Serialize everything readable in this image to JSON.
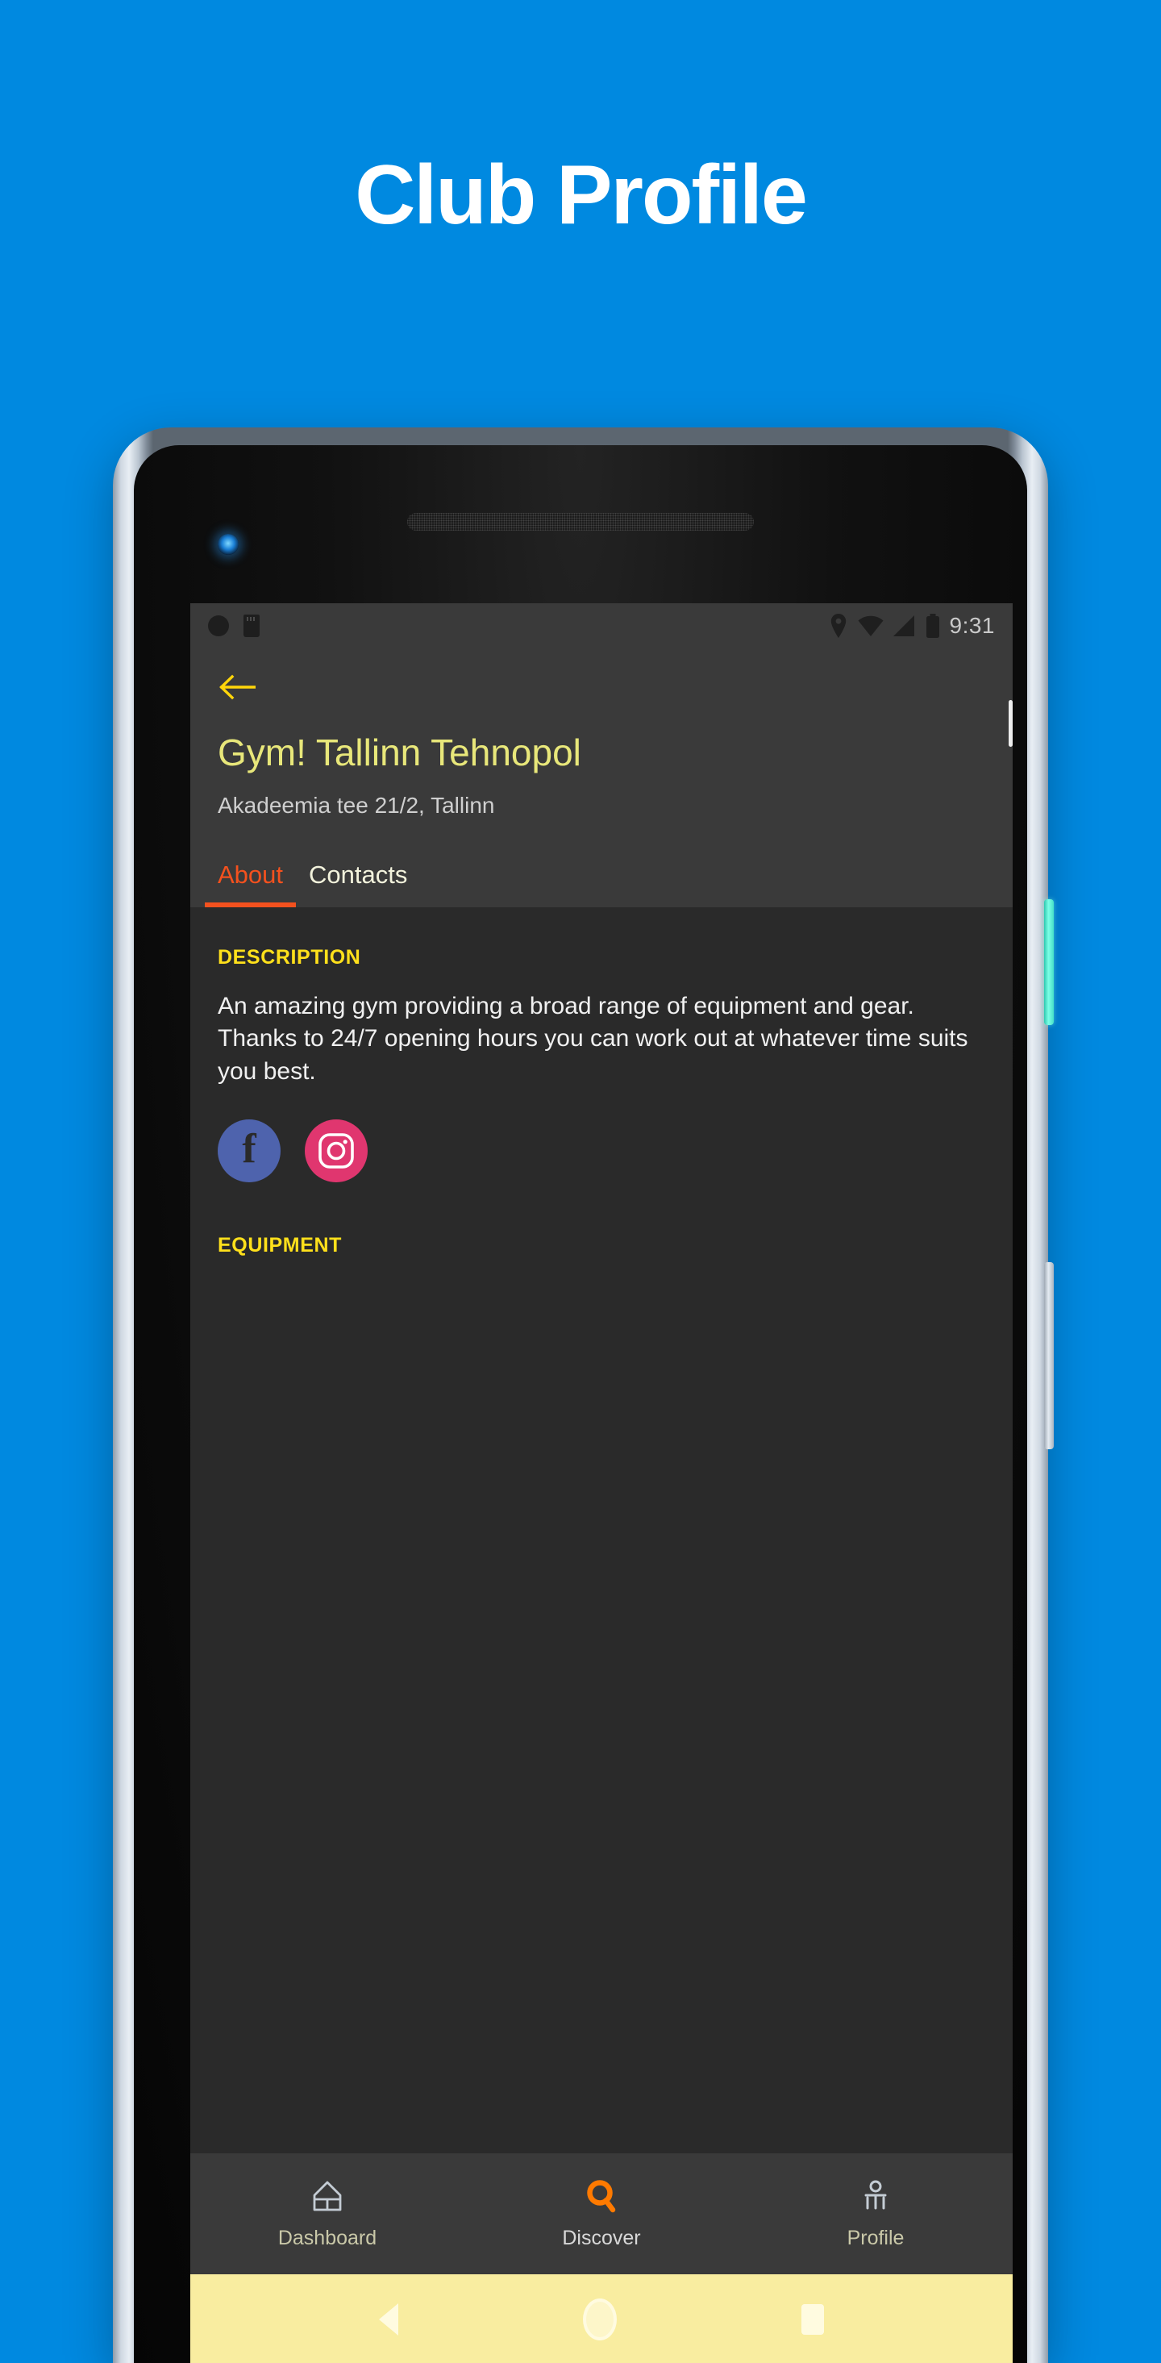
{
  "page": {
    "heading": "Club Profile",
    "background_color": "#0089e0"
  },
  "device": {
    "frame_color": "#cfd8e2",
    "power_button_color": "#7dffe6",
    "volume_button_color": "#e4ebf2",
    "camera_lens": "camera-lens",
    "speaker": "speaker-grille"
  },
  "status_bar": {
    "time": "9:31",
    "icons": [
      "location-pin-icon",
      "wifi-icon",
      "cellular-signal-icon",
      "battery-icon"
    ],
    "left_icons": [
      "notification-dot-icon",
      "sim-card-icon"
    ],
    "background": "#3a3a3a"
  },
  "app_header": {
    "back_icon": "back-arrow-icon",
    "back_icon_color": "#ffd60a",
    "title": "Gym! Tallinn Tehnopol",
    "title_color": "#e8e77a",
    "address": "Akadeemia tee 21/2, Tallinn",
    "address_color": "#cfcfcf",
    "background": "#3a3a3a"
  },
  "tabs": [
    {
      "label": "About",
      "active": true,
      "color": "#f4511e"
    },
    {
      "label": "Contacts",
      "active": false,
      "color": "#f2f2dc"
    }
  ],
  "content": {
    "background": "#2a2a2a",
    "description_label": "DESCRIPTION",
    "description_label_color": "#ffe01b",
    "description_text": "An amazing gym providing a broad range of equipment and gear. Thanks to 24/7 opening hours you can work out at whatever time suits you best.",
    "equipment_label": "EQUIPMENT",
    "social": [
      {
        "name": "facebook",
        "icon": "facebook-icon",
        "color": "#4e63ad",
        "glyph": "f"
      },
      {
        "name": "instagram",
        "icon": "instagram-icon",
        "color": "#e0366f",
        "glyph": ""
      }
    ]
  },
  "bottom_nav": {
    "background": "#3a3a3a",
    "items": [
      {
        "label": "Dashboard",
        "icon": "home-icon",
        "active": false,
        "color": "#c9c8a8",
        "icon_color": "#c4ccd4"
      },
      {
        "label": "Discover",
        "icon": "search-icon",
        "active": true,
        "color": "#d8d8d8",
        "icon_color": "#ff7a00"
      },
      {
        "label": "Profile",
        "icon": "person-icon",
        "active": false,
        "color": "#c9c8a8",
        "icon_color": "#c4ccd4"
      }
    ]
  },
  "system_nav": {
    "background": "#f9eda0",
    "buttons": [
      {
        "name": "back",
        "icon": "triangle-back-icon"
      },
      {
        "name": "home",
        "icon": "circle-home-icon"
      },
      {
        "name": "recents",
        "icon": "square-recents-icon"
      }
    ]
  }
}
